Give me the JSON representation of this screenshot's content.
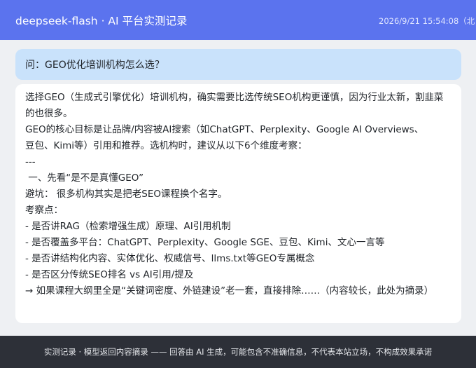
{
  "header": {
    "app_name": "deepseek-flash",
    "separator": " · ",
    "subtitle": "AI 平台实测记录",
    "timestamp": "2026/9/21 15:54:08（北"
  },
  "question": {
    "text": "问：GEO优化培训机构怎么选？"
  },
  "answer": {
    "paragraph_1": "选择GEO（生成式引擎优化）培训机构，确实需要比选传统SEO机构更谨慎，因为行业太新，割韭菜的也很多。",
    "paragraph_2_line_1": "GEO的核心目标是让品牌/内容被AI搜索（如ChatGPT、Perplexity、Google AI Overviews、",
    "paragraph_2_line_2": "豆包、Kimi等）引用和推荐。选机构时，建议从以下6个维度考察：",
    "divider": "---",
    "section_heading": " 一、先看“是不是真懂GEO”",
    "pitfall": "避坑： 很多机构其实是把老SEO课程换个名字。",
    "checklist_label": "考察点：",
    "checklist": [
      "- 是否讲RAG（检索增强生成）原理、AI引用机制",
      "- 是否覆盖多平台：ChatGPT、Perplexity、Google SGE、豆包、Kimi、文心一言等",
      "- 是否讲结构化内容、实体优化、权威信号、llms.txt等GEO专属概念",
      "- 是否区分传统SEO排名 vs AI引用/提及"
    ],
    "conclusion": "→ 如果课程大纲里全是“关键词密度、外链建设”老一套，直接排除……（内容较长，此处为摘录）"
  },
  "footer": {
    "disclaimer": "实测记录 · 模型返回内容摘录 —— 回答由 AI 生成，可能包含不准确信息，不代表本站立场，不构成效果承诺"
  },
  "colors": {
    "header_bg": "#5b73ee",
    "question_bg": "#c9e2fb",
    "footer_bg": "#2d3038",
    "page_bg": "#eef0f3"
  }
}
